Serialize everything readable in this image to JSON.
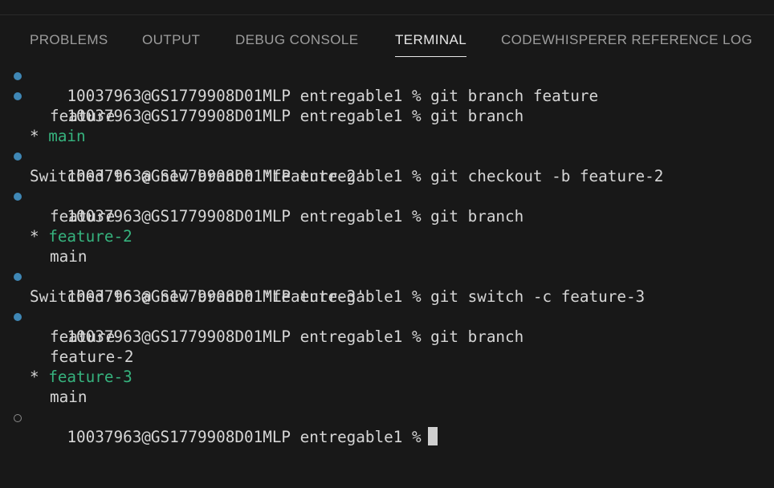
{
  "tabs": {
    "problems": "PROBLEMS",
    "output": "OUTPUT",
    "debug_console": "DEBUG CONSOLE",
    "terminal": "TERMINAL",
    "codewhisperer": "CODEWHISPERER REFERENCE LOG"
  },
  "terminal": {
    "prompt": "10037963@GS1779908D01MLP entregable1 %",
    "lines": [
      {
        "cmd": "git branch feature"
      },
      {
        "cmd": "git branch"
      },
      {
        "out": "feature"
      },
      {
        "star": "*",
        "current": "main"
      },
      {
        "cmd": "git checkout -b feature-2"
      },
      {
        "msg": "Switched to a new branch 'feature-2'"
      },
      {
        "cmd": "git branch"
      },
      {
        "out": "feature"
      },
      {
        "star": "*",
        "current": "feature-2"
      },
      {
        "out": "main"
      },
      {
        "cmd": "git switch -c feature-3"
      },
      {
        "msg": "Switched to a new branch 'feature-3'"
      },
      {
        "cmd": "git branch"
      },
      {
        "out": "feature"
      },
      {
        "out": "feature-2"
      },
      {
        "star": "*",
        "current": "feature-3"
      },
      {
        "out": "main"
      }
    ]
  },
  "colors": {
    "background": "#181818",
    "text": "#d6d6d6",
    "current_branch": "#36b37e",
    "success_dot": "#3f87b5"
  }
}
